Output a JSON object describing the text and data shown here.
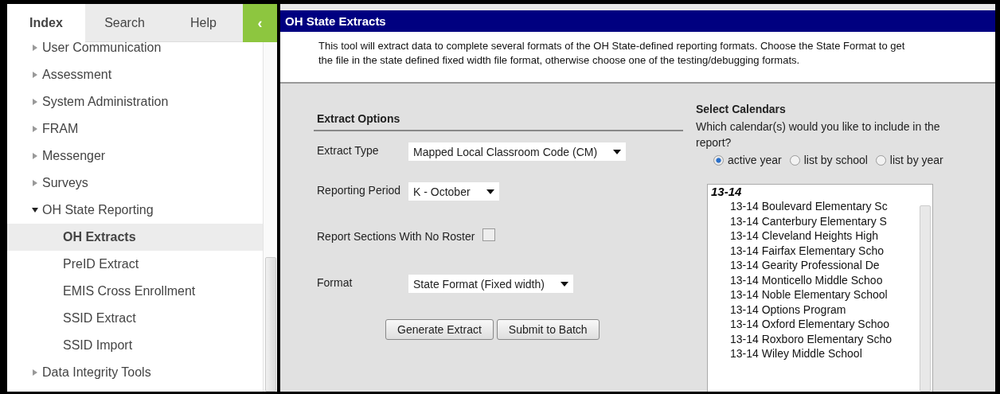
{
  "sidebar": {
    "tabs": [
      {
        "label": "Index",
        "selected": true
      },
      {
        "label": "Search",
        "selected": false
      },
      {
        "label": "Help",
        "selected": false
      }
    ],
    "collapse_button": "‹",
    "items": [
      {
        "label": "User Communication",
        "expanded": false
      },
      {
        "label": "Assessment",
        "expanded": false
      },
      {
        "label": "System Administration",
        "expanded": false
      },
      {
        "label": "FRAM",
        "expanded": false
      },
      {
        "label": "Messenger",
        "expanded": false
      },
      {
        "label": "Surveys",
        "expanded": false
      },
      {
        "label": "OH State Reporting",
        "expanded": true,
        "children": [
          {
            "label": "OH Extracts",
            "selected": true
          },
          {
            "label": "PreID Extract",
            "selected": false
          },
          {
            "label": "EMIS Cross Enrollment",
            "selected": false
          },
          {
            "label": "SSID Extract",
            "selected": false
          },
          {
            "label": "SSID Import",
            "selected": false
          }
        ]
      },
      {
        "label": "Data Integrity Tools",
        "expanded": false
      }
    ]
  },
  "panel": {
    "title": "OH State Extracts",
    "description": "This tool will extract data to complete several formats of the OH State-defined reporting formats. Choose the State Format to get the file in the state defined fixed width file format, otherwise choose one of the testing/debugging formats.",
    "extract_options": {
      "heading": "Extract Options",
      "fields": [
        {
          "kind": "select",
          "label": "Extract Type",
          "value": "Mapped Local Classroom Code (CM)"
        },
        {
          "kind": "select",
          "label": "Reporting Period",
          "value": "K - October"
        },
        {
          "kind": "checkbox",
          "label": "Report Sections With No Roster",
          "checked": false
        },
        {
          "kind": "select",
          "label": "Format",
          "value": "State Format (Fixed width)"
        }
      ],
      "buttons": [
        "Generate Extract",
        "Submit to Batch"
      ]
    },
    "calendars": {
      "heading": "Select Calendars",
      "question": "Which calendar(s) would you like to include in the report?",
      "options": [
        {
          "label": "active year",
          "selected": true
        },
        {
          "label": "list by school",
          "selected": false
        },
        {
          "label": "list by year",
          "selected": false
        }
      ],
      "group": "13-14",
      "items": [
        "13-14 Boulevard Elementary Sc",
        "13-14 Canterbury Elementary S",
        "13-14 Cleveland Heights High",
        "13-14 Fairfax Elementary Scho",
        "13-14 Gearity Professional De",
        "13-14 Monticello Middle Schoo",
        "13-14 Noble Elementary School",
        "13-14 Options Program",
        "13-14 Oxford Elementary Schoo",
        "13-14 Roxboro Elementary Scho",
        "13-14 Wiley Middle School"
      ]
    }
  }
}
